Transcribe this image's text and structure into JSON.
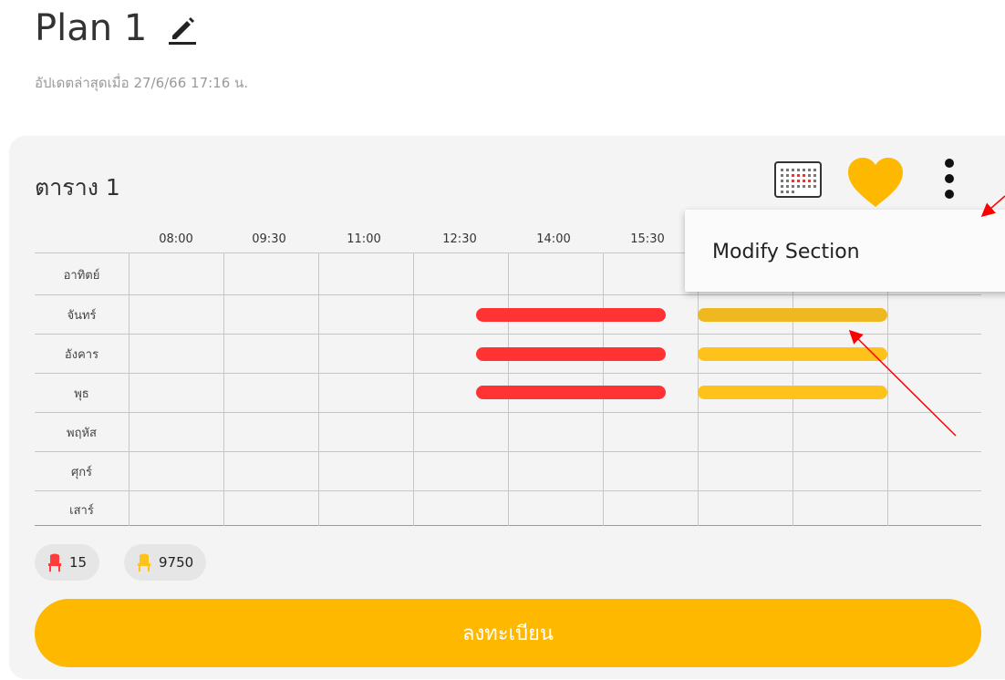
{
  "header": {
    "title": "Plan 1",
    "updated_text": "อัปเดตล่าสุดเมื่อ 27/6/66 17:16 น."
  },
  "card": {
    "title": "ตาราง 1",
    "times": [
      "08:00",
      "09:30",
      "11:00",
      "12:30",
      "14:00",
      "15:30"
    ],
    "days": [
      "อาทิตย์",
      "จันทร์",
      "อังคาร",
      "พุธ",
      "พฤหัส",
      "ศุกร์",
      "เสาร์"
    ],
    "chips": [
      {
        "value": "15",
        "color": "#ff3b3b"
      },
      {
        "value": "9750",
        "color": "#ffc21a"
      }
    ],
    "register_label": "ลงทะเบียน"
  },
  "menu": {
    "item_label": "Modify Section"
  },
  "colors": {
    "accent": "#ffb800",
    "heart": "#ffb800",
    "bar_red": "#ff3333",
    "bar_yellow": "#ffc21a",
    "annotation_arrow": "#ff0000"
  },
  "icons": [
    "pencil-icon",
    "calendar-grid-icon",
    "heart-icon",
    "more-vertical-icon",
    "seat-icon"
  ]
}
